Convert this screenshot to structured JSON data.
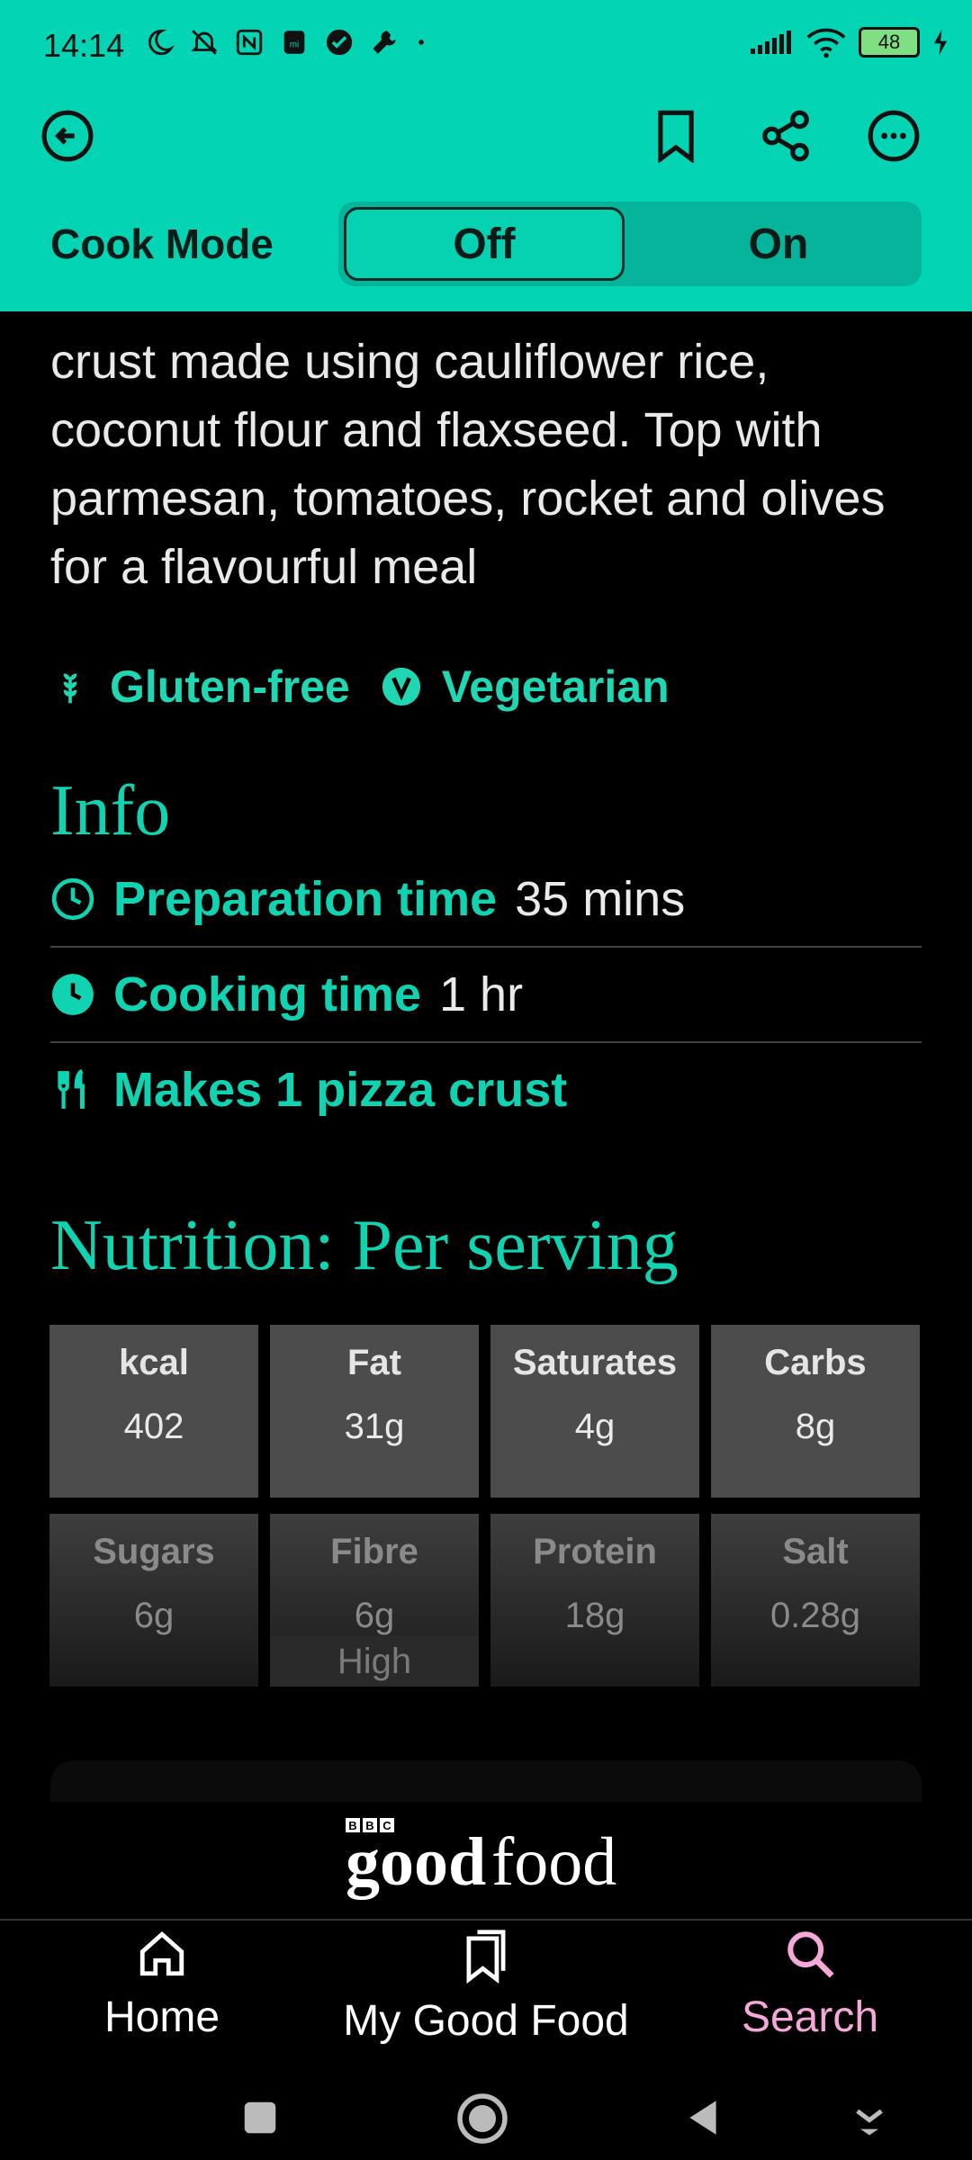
{
  "status": {
    "time": "14:14",
    "battery": "48"
  },
  "colors": {
    "brand": "#03d4b3",
    "accent": "#10d4b1",
    "search_active": "#f7a8da"
  },
  "header": {
    "cook_mode_label": "Cook Mode",
    "toggle_off": "Off",
    "toggle_on": "On"
  },
  "description": "crust made using cauliflower rice, coconut flour and flaxseed. Top with parmesan, tomatoes, rocket and olives for a flavourful meal",
  "tags": [
    {
      "label": "Gluten-free",
      "icon": "wheat-icon"
    },
    {
      "label": "Vegetarian",
      "icon": "vegetarian-icon"
    }
  ],
  "info": {
    "title": "Info",
    "rows": [
      {
        "label": "Preparation time",
        "value": "35 mins",
        "icon": "clock-outline-icon"
      },
      {
        "label": "Cooking time",
        "value": "1 hr",
        "icon": "clock-filled-icon"
      },
      {
        "label": "Makes 1 pizza crust",
        "value": "",
        "icon": "cutlery-icon"
      }
    ]
  },
  "nutrition": {
    "title": "Nutrition: Per serving",
    "items": [
      {
        "label": "kcal",
        "value": "402"
      },
      {
        "label": "Fat",
        "value": "31g"
      },
      {
        "label": "Saturates",
        "value": "4g"
      },
      {
        "label": "Carbs",
        "value": "8g"
      },
      {
        "label": "Sugars",
        "value": "6g"
      },
      {
        "label": "Fibre",
        "value": "6g",
        "note": "High"
      },
      {
        "label": "Protein",
        "value": "18g"
      },
      {
        "label": "Salt",
        "value": "0.28g"
      }
    ]
  },
  "logo": {
    "bbc": "BBC",
    "text": "goodfood"
  },
  "nav": {
    "items": [
      {
        "label": "Home",
        "icon": "home-icon"
      },
      {
        "label": "My Good Food",
        "icon": "bookmarks-icon"
      },
      {
        "label": "Search",
        "icon": "search-icon",
        "active": true
      }
    ]
  }
}
